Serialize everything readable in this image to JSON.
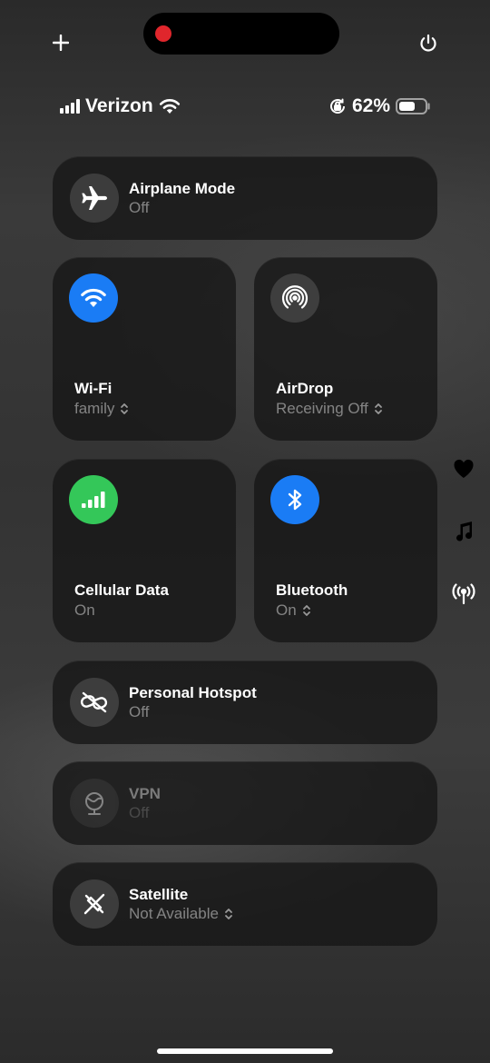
{
  "status_bar": {
    "carrier": "Verizon",
    "battery_percent": "62%",
    "battery_level": 0.62
  },
  "controls": {
    "airplane": {
      "title": "Airplane Mode",
      "status": "Off",
      "icon": "airplane-icon"
    },
    "wifi": {
      "title": "Wi-Fi",
      "status": "family",
      "icon": "wifi-icon",
      "color": "#1a7cf5"
    },
    "airdrop": {
      "title": "AirDrop",
      "status": "Receiving Off",
      "icon": "airdrop-icon"
    },
    "cellular": {
      "title": "Cellular Data",
      "status": "On",
      "icon": "cellular-icon",
      "color": "#34c759"
    },
    "bluetooth": {
      "title": "Bluetooth",
      "status": "On",
      "icon": "bluetooth-icon",
      "color": "#1a7cf5"
    },
    "hotspot": {
      "title": "Personal Hotspot",
      "status": "Off",
      "icon": "hotspot-icon"
    },
    "vpn": {
      "title": "VPN",
      "status": "Off",
      "icon": "vpn-icon"
    },
    "satellite": {
      "title": "Satellite",
      "status": "Not Available",
      "icon": "satellite-icon"
    }
  },
  "side_icons": [
    "heart-icon",
    "music-note-icon",
    "antenna-icon"
  ]
}
